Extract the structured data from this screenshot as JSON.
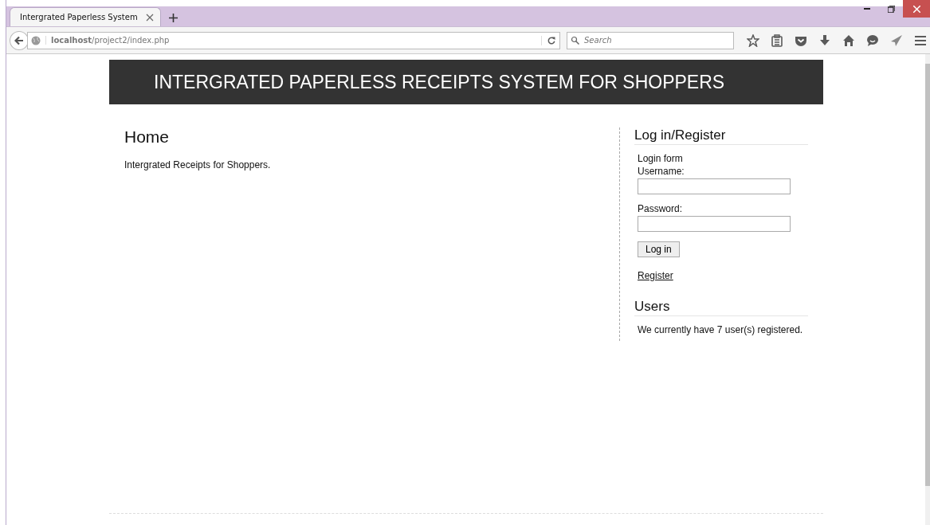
{
  "browser": {
    "tab_title": "Intergrated Paperless System",
    "address": "**localhost**/project2/index.php",
    "search": {
      "placeholder": "Search"
    }
  },
  "header": {
    "title": "INTERGRATED PAPERLESS RECEIPTS SYSTEM FOR SHOPPERS"
  },
  "main": {
    "heading": "Home",
    "text": "Intergrated Receipts for Shoppers."
  },
  "sidebar": {
    "login_heading": "Log in/Register",
    "form_title": "Login form",
    "username_label": "Username:",
    "password_label": "Password:",
    "login_button": "Log in",
    "register_link": "Register",
    "users_heading": "Users",
    "users_text": "We currently have 7 user(s) registered."
  }
}
